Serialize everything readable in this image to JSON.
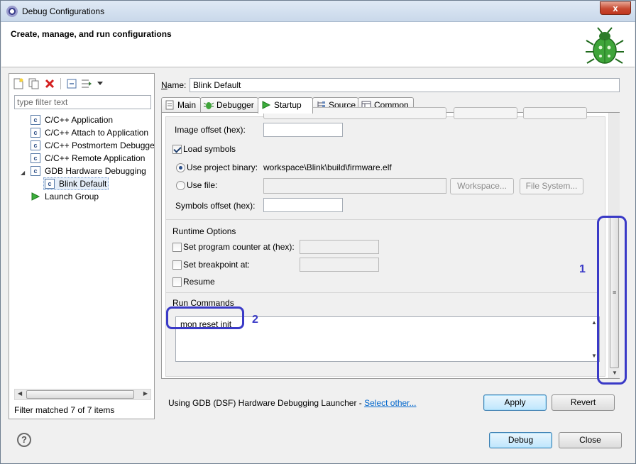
{
  "window": {
    "title": "Debug Configurations",
    "close_glyph": "x"
  },
  "header": {
    "title": "Create, manage, and run configurations"
  },
  "left": {
    "filter_placeholder": "type filter text",
    "tree": [
      {
        "label": "C/C++ Application",
        "icon": "c-app-icon"
      },
      {
        "label": "C/C++ Attach to Application",
        "icon": "c-app-icon"
      },
      {
        "label": "C/C++ Postmortem Debugger",
        "icon": "c-app-icon"
      },
      {
        "label": "C/C++ Remote Application",
        "icon": "c-app-icon"
      },
      {
        "label": "GDB Hardware Debugging",
        "icon": "c-app-icon",
        "expanded": true
      },
      {
        "label": "Blink Default",
        "icon": "c-app-icon",
        "selected": true
      },
      {
        "label": "Launch Group",
        "icon": "launch-icon"
      }
    ],
    "filter_status": "Filter matched 7 of 7 items"
  },
  "config": {
    "name_label": "Name:",
    "name_value": "Blink Default",
    "tabs": [
      {
        "label": "Main",
        "icon": "main-tab-icon"
      },
      {
        "label": "Debugger",
        "icon": "debugger-tab-icon"
      },
      {
        "label": "Startup",
        "icon": "startup-tab-icon",
        "active": true
      },
      {
        "label": "Source",
        "icon": "source-tab-icon"
      },
      {
        "label": "Common",
        "icon": "common-tab-icon"
      }
    ]
  },
  "startup": {
    "image_offset_label": "Image offset (hex):",
    "image_offset_value": "",
    "load_symbols_label": "Load symbols",
    "load_symbols_checked": true,
    "use_project_binary_label": "Use project binary:",
    "project_binary_value": "workspace\\Blink\\build\\firmware.elf",
    "use_file_label": "Use file:",
    "use_file_value": "",
    "workspace_button": "Workspace...",
    "file_system_button": "File System...",
    "symbols_offset_label": "Symbols offset (hex):",
    "symbols_offset_value": "",
    "runtime_title": "Runtime Options",
    "set_pc_label": "Set program counter at (hex):",
    "set_bp_label": "Set breakpoint at:",
    "resume_label": "Resume",
    "run_commands_title": "Run Commands",
    "run_commands_value": "mon reset init"
  },
  "annotations": {
    "one": "1",
    "two": "2",
    "color": "#3a3ac7"
  },
  "footer": {
    "launcher_text": "Using GDB (DSF) Hardware Debugging Launcher - ",
    "select_other": "Select other...",
    "apply": "Apply",
    "revert": "Revert",
    "debug": "Debug",
    "close": "Close",
    "help_glyph": "?"
  }
}
